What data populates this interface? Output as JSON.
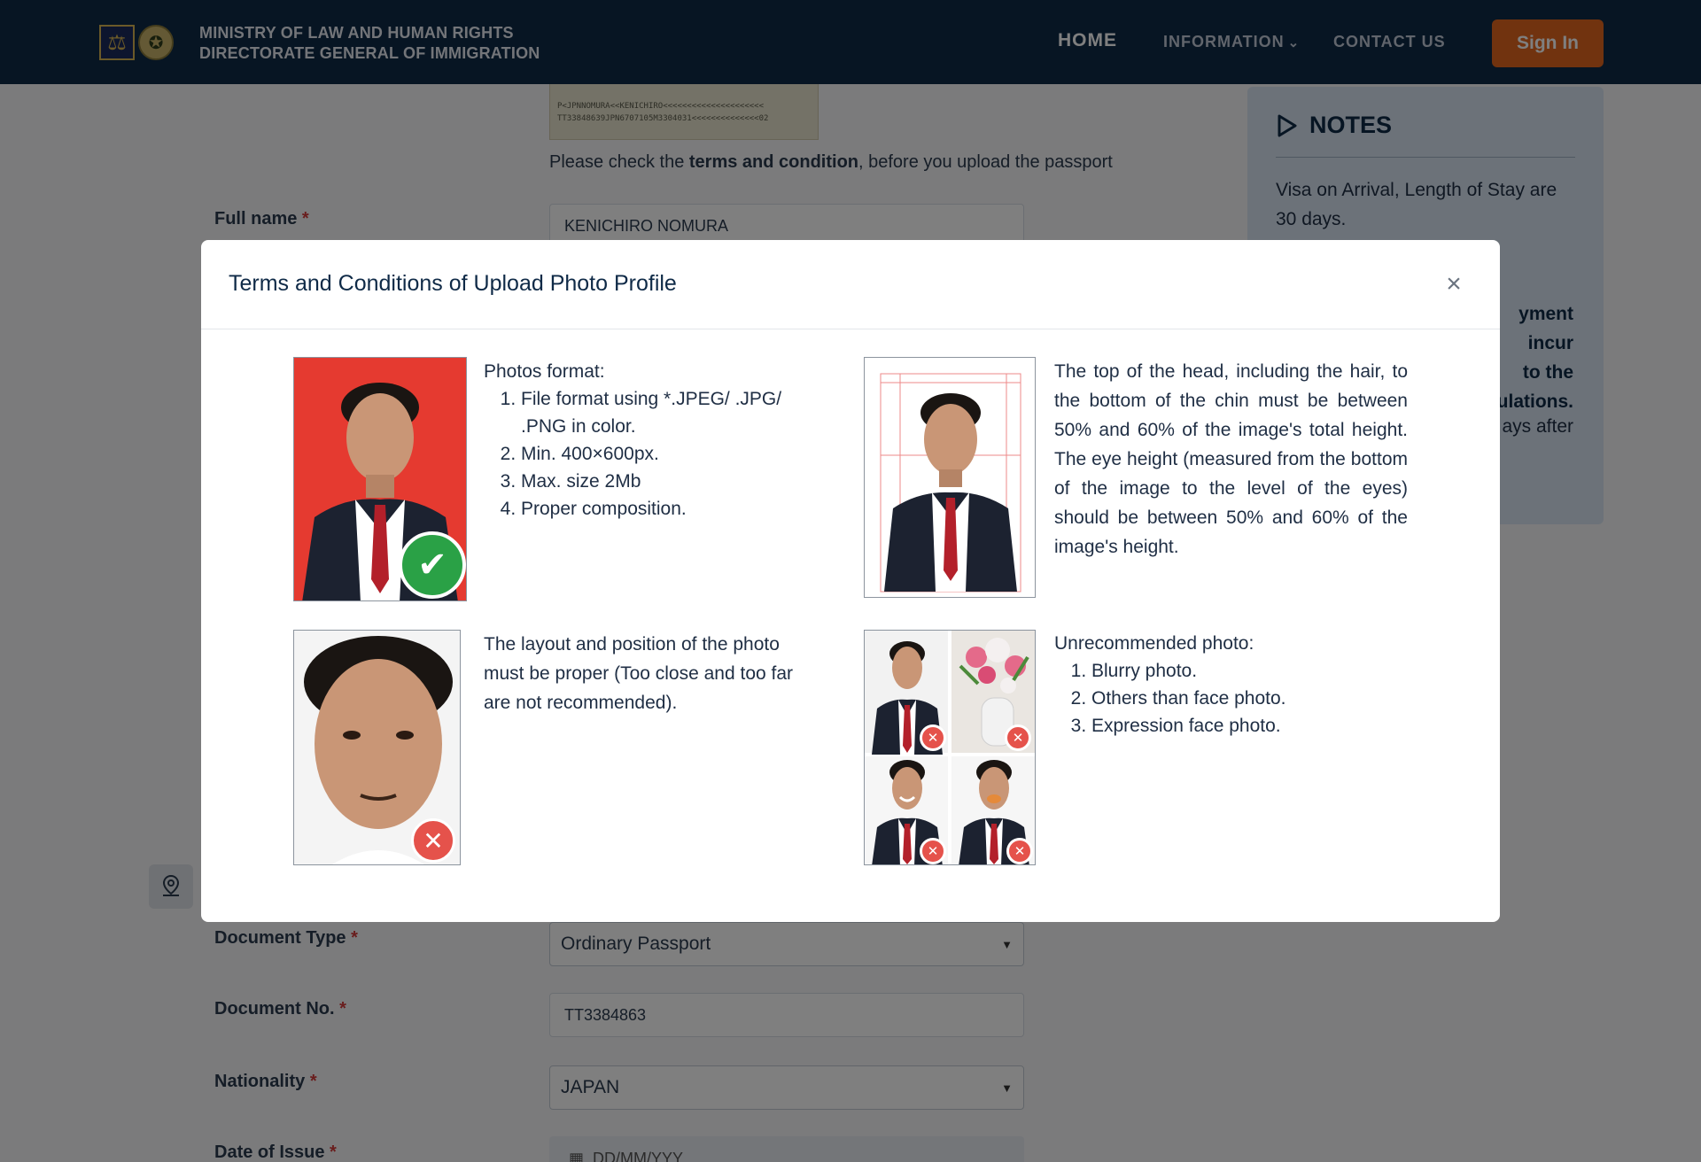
{
  "header": {
    "ministry_line1": "MINISTRY OF  LAW  AND HUMAN RIGHTS",
    "ministry_line2": "DIRECTORATE GENERAL OF IMMIGRATION",
    "nav_home": "HOME",
    "nav_information": "INFORMATION",
    "nav_contact": "CONTACT US",
    "signin": "Sign In"
  },
  "background": {
    "passport_mrz_line1": "P<JPNNOMURA<<KENICHIRO<<<<<<<<<<<<<<<<<<<<<",
    "passport_mrz_line2": "TT33848639JPN6707105M3304031<<<<<<<<<<<<<<02",
    "check_prefix": "Please check the ",
    "check_link": "terms and condition",
    "check_suffix": ", before you upload the passport",
    "fields": {
      "full_name_label": "Full name",
      "full_name_value": "KENICHIRO NOMURA",
      "document_type_label": "Document Type",
      "document_type_value": "Ordinary Passport",
      "document_no_label": "Document No.",
      "document_no_value": "TT3384863",
      "nationality_label": "Nationality",
      "nationality_value": "JAPAN",
      "date_of_issue_label": "Date of Issue",
      "date_of_issue_placeholder": "DD/MM/YYY"
    },
    "required_mark": "*",
    "notes": {
      "title": "NOTES",
      "body": "Visa on Arrival, Length of Stay are 30 days.",
      "bold_line1": "yment",
      "bold_line2": "incur",
      "bold_line3": "to the",
      "bold_line4": "ulations.",
      "tail": "ays after"
    }
  },
  "modal": {
    "title": "Terms and Conditions of Upload Photo Profile",
    "close": "×",
    "format_title": "Photos format:",
    "format_items": [
      "File format using *.JPEG/ .JPG/ .PNG in color.",
      "Min. 400×600px.",
      "Max. size 2Mb",
      "Proper composition."
    ],
    "head_rule": "The top of the head, including the hair, to the bottom of the chin must be between 50% and 60% of the image's total height. The eye height (measured from the bottom of the image to the level of the eyes) should be between 50% and 60% of the image's height.",
    "layout_rule": "The layout and position of the photo must be proper (Too close and too far are not recommended).",
    "unrec_title": "Unrecommended photo:",
    "unrec_items": [
      "Blurry photo.",
      "Others than face photo.",
      "Expression face photo."
    ],
    "icons": {
      "ok": "check-icon",
      "no": "cross-icon"
    }
  }
}
